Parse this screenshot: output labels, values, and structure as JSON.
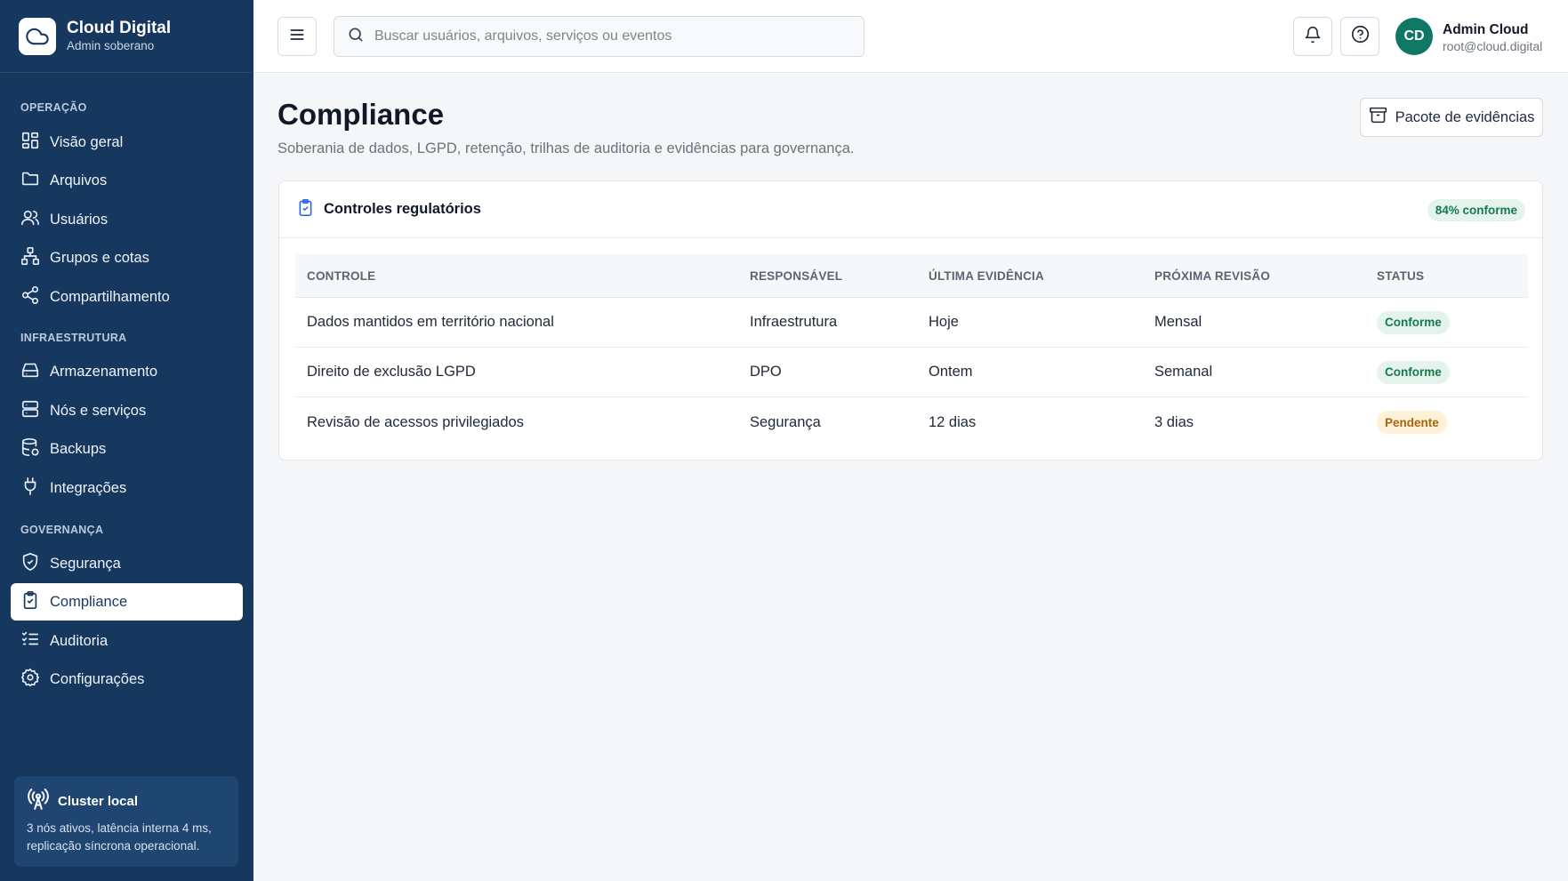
{
  "brand": {
    "title": "Cloud Digital",
    "subtitle": "Admin soberano"
  },
  "sidebar": {
    "sections": [
      {
        "title": "OPERAÇÃO"
      },
      {
        "title": "INFRAESTRUTURA"
      },
      {
        "title": "GOVERNANÇA"
      }
    ],
    "items": [
      {
        "label": "Visão geral",
        "icon": "dashboard-icon"
      },
      {
        "label": "Arquivos",
        "icon": "folder-icon"
      },
      {
        "label": "Usuários",
        "icon": "users-icon"
      },
      {
        "label": "Grupos e cotas",
        "icon": "network-icon"
      },
      {
        "label": "Compartilhamento",
        "icon": "share-icon"
      },
      {
        "label": "Armazenamento",
        "icon": "hard-drive-icon"
      },
      {
        "label": "Nós e serviços",
        "icon": "server-icon"
      },
      {
        "label": "Backups",
        "icon": "database-backup-icon"
      },
      {
        "label": "Integrações",
        "icon": "plug-icon"
      },
      {
        "label": "Segurança",
        "icon": "shield-icon"
      },
      {
        "label": "Compliance",
        "icon": "clipboard-check-icon",
        "active": true
      },
      {
        "label": "Auditoria",
        "icon": "list-checks-icon"
      },
      {
        "label": "Configurações",
        "icon": "gear-icon"
      }
    ],
    "cluster": {
      "title": "Cluster local",
      "description": "3 nós ativos, latência interna 4 ms, replicação síncrona operacional."
    }
  },
  "topbar": {
    "search_placeholder": "Buscar usuários, arquivos, serviços ou eventos",
    "user": {
      "initials": "CD",
      "name": "Admin Cloud",
      "email": "root@cloud.digital"
    }
  },
  "page": {
    "title": "Compliance",
    "subtitle": "Soberania de dados, LGPD, retenção, trilhas de auditoria e evidências para governança.",
    "evidence_button": "Pacote de evidências"
  },
  "card": {
    "title": "Controles regulatórios",
    "badge": "84% conforme",
    "columns": [
      "CONTROLE",
      "RESPONSÁVEL",
      "ÚLTIMA EVIDÊNCIA",
      "PRÓXIMA REVISÃO",
      "STATUS"
    ],
    "rows": [
      {
        "control": "Dados mantidos em território nacional",
        "owner": "Infraestrutura",
        "last": "Hoje",
        "next": "Mensal",
        "status": "Conforme"
      },
      {
        "control": "Direito de exclusão LGPD",
        "owner": "DPO",
        "last": "Ontem",
        "next": "Semanal",
        "status": "Conforme"
      },
      {
        "control": "Revisão de acessos privilegiados",
        "owner": "Segurança",
        "last": "12 dias",
        "next": "3 dias",
        "status": "Pendente"
      }
    ]
  },
  "colors": {
    "sidebar_bg": "#16375e",
    "ok": "#157a4d",
    "pending": "#a8650d",
    "avatar": "#0f7763"
  }
}
